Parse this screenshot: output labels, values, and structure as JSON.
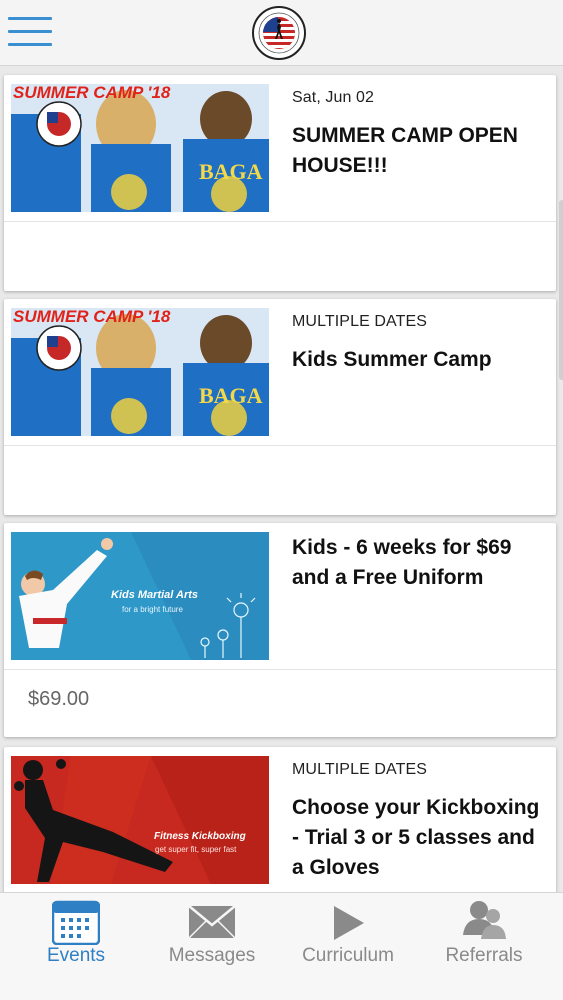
{
  "header": {
    "menu_icon": "hamburger-menu-icon",
    "logo_icon": "american-top-team-logo",
    "logo_text": "AMERICAN TOP TEAM"
  },
  "events": [
    {
      "date": "Sat, Jun 02",
      "title": "SUMMER CAMP OPEN HOUSE!!!",
      "thumb_text": "SUMMER CAMP '18",
      "thumb_shirt": "BAGA",
      "price": ""
    },
    {
      "date": "MULTIPLE DATES",
      "title": "Kids Summer Camp",
      "thumb_text": "SUMMER CAMP '18",
      "thumb_shirt": "BAGA",
      "price": ""
    },
    {
      "date": "",
      "title": "Kids - 6 weeks for $69 and a Free Uniform",
      "thumb_text": "Kids Martial Arts",
      "thumb_sub": "for a bright future",
      "price": "$69.00"
    },
    {
      "date": "MULTIPLE DATES",
      "title": "Choose your Kickboxing - Trial 3 or 5 classes and a Gloves",
      "thumb_text": "Fitness Kickboxing",
      "thumb_sub": "get super fit, super fast",
      "price": ""
    }
  ],
  "tabs": [
    {
      "label": "Events",
      "icon": "calendar-icon",
      "active": true
    },
    {
      "label": "Messages",
      "icon": "envelope-icon",
      "active": false
    },
    {
      "label": "Curriculum",
      "icon": "play-icon",
      "active": false
    },
    {
      "label": "Referrals",
      "icon": "people-icon",
      "active": false
    }
  ],
  "colors": {
    "accent": "#2f7fc4",
    "tab_inactive": "#8a8a8a",
    "camp_bg": "#1f6fc4",
    "kids_bg": "#2e98c9",
    "kickbox_bg": "#c7281f"
  }
}
